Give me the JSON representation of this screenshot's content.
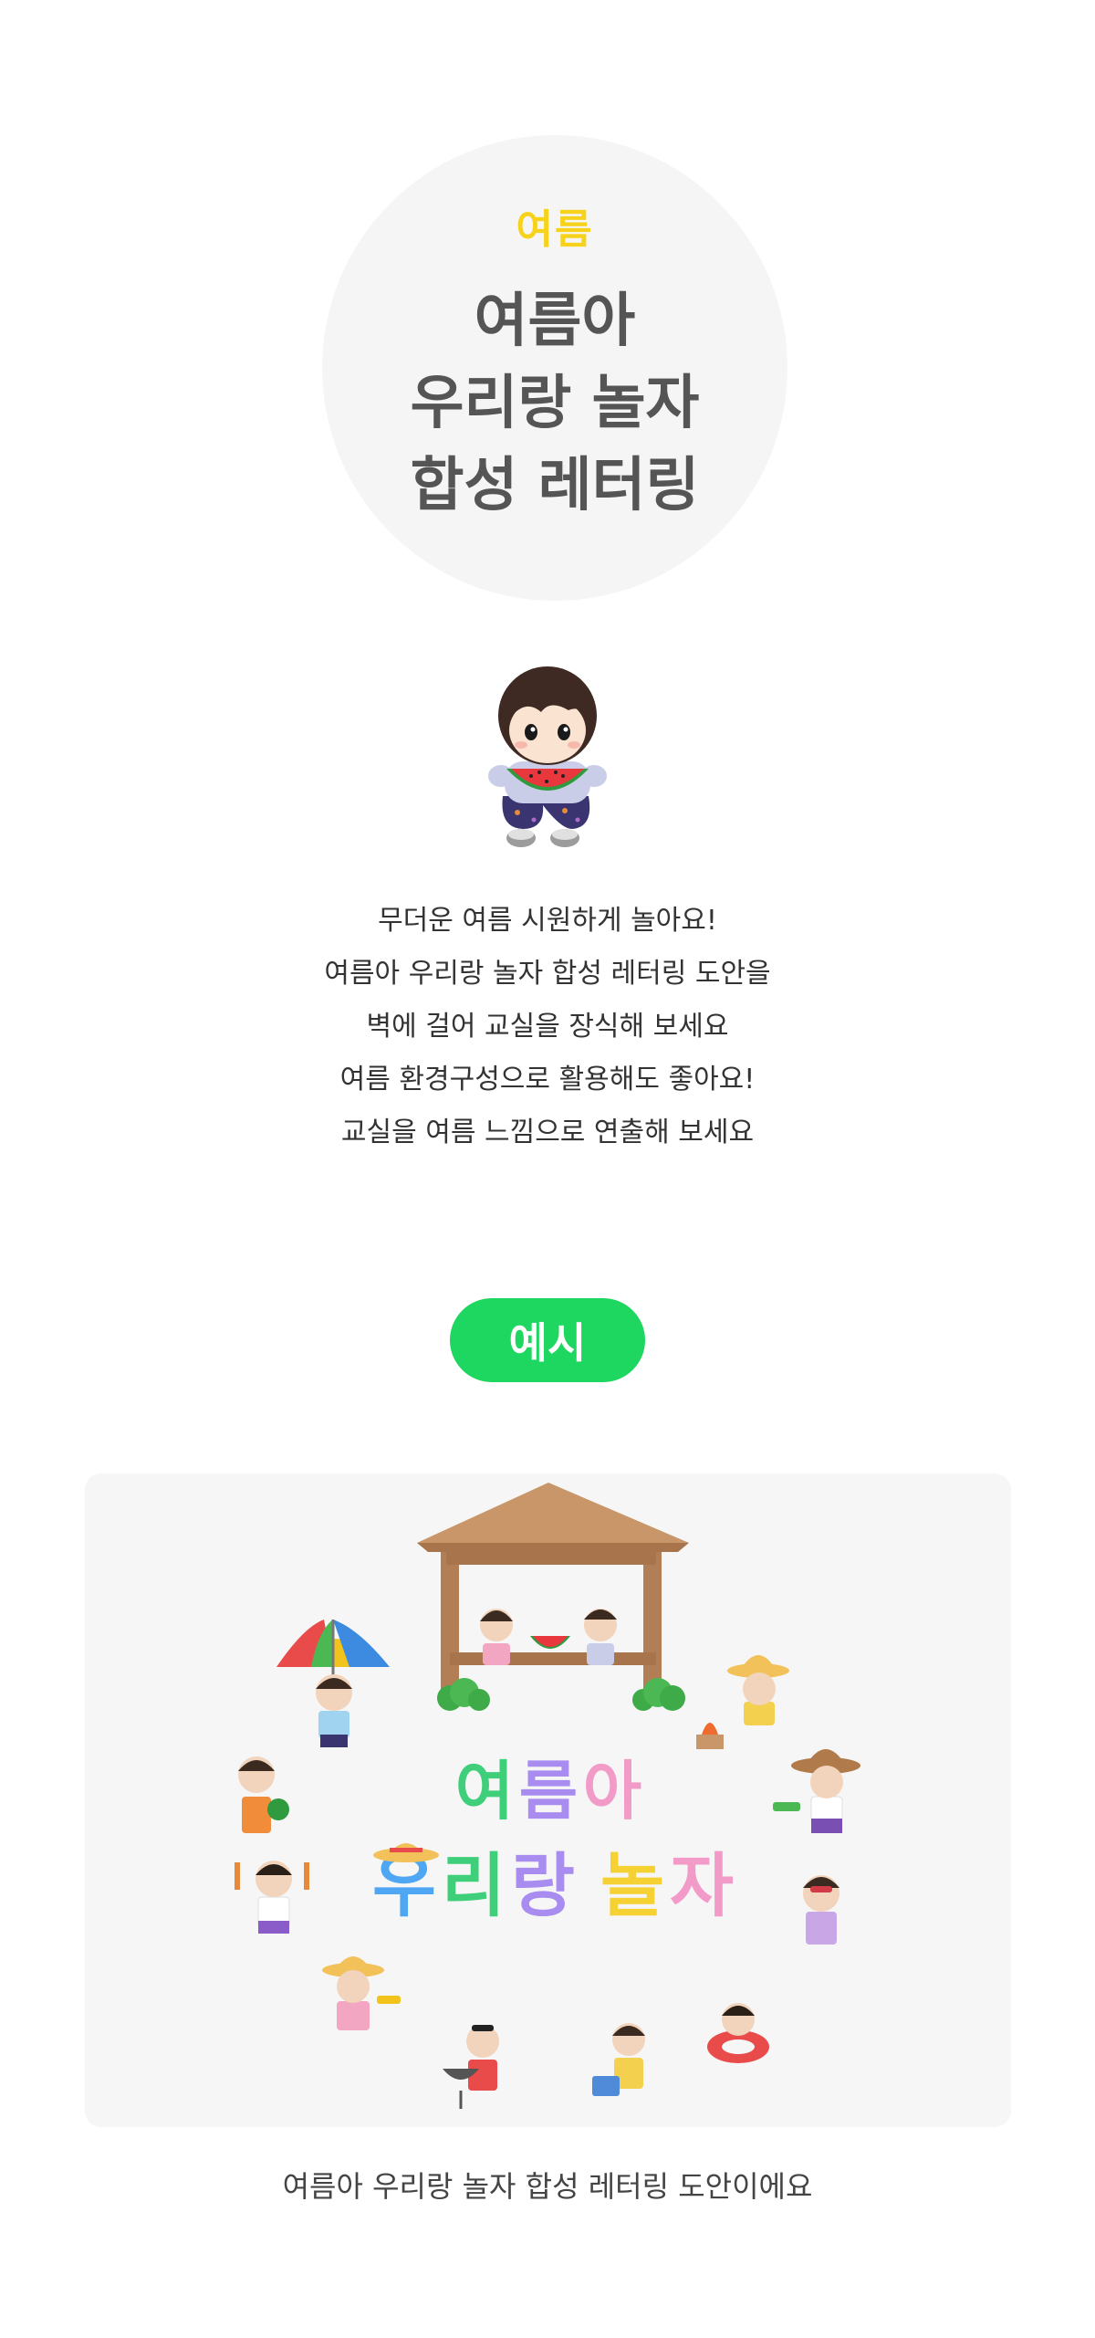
{
  "hero": {
    "season": "여름",
    "title_lines": [
      "여름아",
      "우리랑 놀자",
      "합성 레터링"
    ]
  },
  "description": [
    "무더운 여름 시원하게 놀아요!",
    "여름아 우리랑 놀자 합성 레터링 도안을",
    "벽에 걸어 교실을 장식해 보세요",
    "여름 환경구성으로 활용해도 좋아요!",
    "교실을 여름 느낌으로 연출해 보세요"
  ],
  "example": {
    "label": "예시",
    "lettering_line1": [
      "여",
      "름",
      "아"
    ],
    "lettering_line2": [
      "우",
      "리",
      "랑",
      "놀",
      "자"
    ],
    "caption": "여름아 우리랑 놀자 합성 레터링 도안이에요"
  },
  "colors": {
    "accent_yellow": "#f6d21a",
    "accent_green": "#1ed760",
    "title_gray": "#555555",
    "circle_bg": "#f5f5f5"
  }
}
